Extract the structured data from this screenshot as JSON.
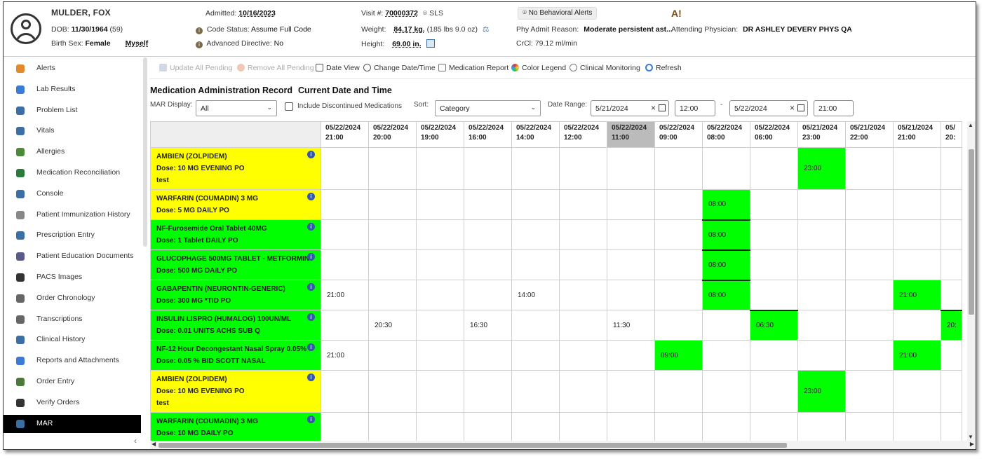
{
  "patient": {
    "name": "MULDER, FOX",
    "dob_label": "DOB:",
    "dob": "11/30/1964",
    "age": "(59)",
    "birth_sex_label": "Birth Sex:",
    "birth_sex": "Female",
    "myself": "Myself",
    "admitted_label": "Admitted:",
    "admitted": "10/16/2023",
    "code_status_label": "Code Status:",
    "code_status": "Assume Full Code",
    "adv_dir_label": "Advanced Directive:",
    "adv_dir": "No",
    "visit_label": "Visit #:",
    "visit": "70000372",
    "location": "SLS",
    "weight_label": "Weight:",
    "weight": "84.17 kg.",
    "weight_lbs": "(185 lbs 9.0 oz)",
    "height_label": "Height:",
    "height": "69.00 in.",
    "behavioral_alerts": "No Behavioral Alerts",
    "phy_admit_label": "Phy Admit Reason:",
    "phy_admit": "Moderate persistent ast...",
    "crcl": "CrCl: 79.12 ml/min",
    "attending_label": "Attending Physician:",
    "attending": "DR ASHLEY DEVERY PHYS QA",
    "warn_icon": "A!"
  },
  "sidebar": {
    "items": [
      {
        "label": "Alerts",
        "icon": "alert-icon",
        "color": "#e08a2a"
      },
      {
        "label": "Lab Results",
        "icon": "lab-icon",
        "color": "#3a7bd5"
      },
      {
        "label": "Problem List",
        "icon": "problem-list-icon",
        "color": "#3a6ea5"
      },
      {
        "label": "Vitals",
        "icon": "vitals-icon",
        "color": "#3a6ea5"
      },
      {
        "label": "Allergies",
        "icon": "allergies-icon",
        "color": "#4a8a3a"
      },
      {
        "label": "Medication Reconciliation",
        "icon": "med-rec-icon",
        "color": "#2a7a3a"
      },
      {
        "label": "Console",
        "icon": "console-icon",
        "color": "#3a6ea5"
      },
      {
        "label": "Patient Immunization History",
        "icon": "syringe-icon",
        "color": "#888888"
      },
      {
        "label": "Prescription Entry",
        "icon": "prescription-icon",
        "color": "#3a6ea5"
      },
      {
        "label": "Patient Education Documents",
        "icon": "education-icon",
        "color": "#5a5a8a"
      },
      {
        "label": "PACS Images",
        "icon": "pacs-icon",
        "color": "#333333"
      },
      {
        "label": "Order Chronology",
        "icon": "chronology-icon",
        "color": "#666666"
      },
      {
        "label": "Transcriptions",
        "icon": "transcription-icon",
        "color": "#666666"
      },
      {
        "label": "Clinical History",
        "icon": "clinical-history-icon",
        "color": "#3a6ea5"
      },
      {
        "label": "Reports and Attachments",
        "icon": "attachment-icon",
        "color": "#3a7bd5"
      },
      {
        "label": "Order Entry",
        "icon": "order-entry-icon",
        "color": "#4a7a3a"
      },
      {
        "label": "Verify Orders",
        "icon": "verify-icon",
        "color": "#333333"
      },
      {
        "label": "MAR",
        "icon": "mar-icon",
        "color": "#3a6ea5",
        "active": true
      }
    ],
    "collapse": "‹"
  },
  "toolbar": {
    "update_all": "Update All Pending",
    "remove_all": "Remove All Pending",
    "date_view": "Date View",
    "change_date": "Change Date/Time",
    "med_report": "Medication Report",
    "color_legend": "Color Legend",
    "clinical_monitoring": "Clinical Monitoring",
    "refresh": "Refresh"
  },
  "mar": {
    "title": "Medication Administration Record",
    "subtitle": "Current Date and Time",
    "display_label": "MAR Display:",
    "display_value": "All",
    "include_dc": "Include Discontinued Medications",
    "sort_label": "Sort:",
    "sort_value": "Category",
    "date_range_label": "Date Range:",
    "from_date": "5/21/2024",
    "from_time": "12:00",
    "dash": "-",
    "to_date": "5/22/2024",
    "to_time": "21:00"
  },
  "columns": [
    {
      "d": "05/22/2024",
      "t": "21:00"
    },
    {
      "d": "05/22/2024",
      "t": "20:00"
    },
    {
      "d": "05/22/2024",
      "t": "19:00"
    },
    {
      "d": "05/22/2024",
      "t": "16:00"
    },
    {
      "d": "05/22/2024",
      "t": "14:00"
    },
    {
      "d": "05/22/2024",
      "t": "12:00"
    },
    {
      "d": "05/22/2024",
      "t": "11:00",
      "current": true
    },
    {
      "d": "05/22/2024",
      "t": "09:00"
    },
    {
      "d": "05/22/2024",
      "t": "08:00"
    },
    {
      "d": "05/22/2024",
      "t": "06:00"
    },
    {
      "d": "05/21/2024",
      "t": "23:00"
    },
    {
      "d": "05/21/2024",
      "t": "22:00"
    },
    {
      "d": "05/21/2024",
      "t": "21:00"
    },
    {
      "d": "05/",
      "t": "20:"
    }
  ],
  "medications": [
    {
      "name": "AMBIEN (ZOLPIDEM)",
      "dose": "Dose: 10 MG EVENING PO",
      "note": "test",
      "color": "yellow",
      "h": 60,
      "cells": [
        {
          "col": 10,
          "text": "23:00",
          "g": 1
        }
      ]
    },
    {
      "name": "WARFARIN (COUMADIN) 3 MG",
      "dose": "Dose: 5 MG DAILY PO",
      "color": "yellow",
      "h": 43,
      "cells": [
        {
          "col": 8,
          "text": "08:00",
          "g": 1
        }
      ]
    },
    {
      "name": "NF-Furosemide Oral Tablet 40MG",
      "dose": "Dose: 1 Tablet DAILY PO",
      "color": "green",
      "h": 43,
      "cells": [
        {
          "col": 8,
          "text": "08:00",
          "g": 2
        }
      ]
    },
    {
      "name": "GLUCOPHAGE 500MG TABLET - METFORMIN",
      "dose": "Dose: 500 MG DAILY PO",
      "color": "green",
      "h": 43,
      "cells": [
        {
          "col": 8,
          "text": "08:00",
          "g": 2
        }
      ]
    },
    {
      "name": "GABAPENTIN (NEURONTIN-GENERIC)",
      "dose": "Dose: 300 MG *TID PO",
      "color": "green",
      "h": 43,
      "cells": [
        {
          "col": 0,
          "text": "21:00"
        },
        {
          "col": 4,
          "text": "14:00"
        },
        {
          "col": 8,
          "text": "08:00",
          "g": 2
        },
        {
          "col": 12,
          "text": "21:00",
          "g": 1
        }
      ]
    },
    {
      "name": "INSULIN LISPRO (HUMALOG) 100UN/ML",
      "dose": "Dose: 0.01 UNITS ACHS SUB Q",
      "color": "green",
      "h": 43,
      "cells": [
        {
          "col": 1,
          "text": "20:30"
        },
        {
          "col": 3,
          "text": "16:30"
        },
        {
          "col": 6,
          "text": "11:30"
        },
        {
          "col": 9,
          "text": "06:30",
          "g": 2
        },
        {
          "col": 13,
          "text": "20:",
          "g": 2
        }
      ]
    },
    {
      "name": "NF-12 Hour Decongestant Nasal Spray 0.05%",
      "dose": "Dose: 0.05 % BID SCOTT NASAL",
      "color": "green",
      "h": 43,
      "cells": [
        {
          "col": 0,
          "text": "21:00"
        },
        {
          "col": 7,
          "text": "09:00",
          "g": 1
        },
        {
          "col": 12,
          "text": "21:00",
          "g": 1
        }
      ]
    },
    {
      "name": "AMBIEN (ZOLPIDEM)",
      "dose": "Dose: 10 MG EVENING PO",
      "note": "test",
      "color": "yellow",
      "h": 60,
      "cells": [
        {
          "col": 10,
          "text": "23:00",
          "g": 1
        }
      ]
    },
    {
      "name": "WARFARIN (COUMADIN) 3 MG",
      "dose": "Dose: 10 MG DAILY PO",
      "color": "green",
      "h": 43,
      "cells": []
    }
  ],
  "colors": {
    "due": "#00ff00",
    "pending": "#ffff00",
    "current_col": "#bbbbbb"
  }
}
